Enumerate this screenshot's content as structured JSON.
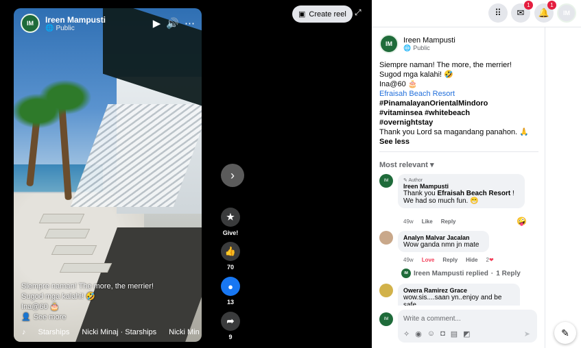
{
  "reel": {
    "author": "Ireen Mampusti",
    "audience": "Public",
    "caption_lines": [
      "Siempre naman! The more, the merrier!",
      "Sugod mga kalahi! 🤣",
      "Ina@60 🎂"
    ],
    "see_more": "See more",
    "music": [
      "Starships",
      "Nicki Minaj · Starships",
      "Nicki Min"
    ],
    "controls": {
      "play_icon": "▶",
      "volume_icon": "🔊",
      "more_icon": "⋯"
    }
  },
  "actions": {
    "give_label": "Give!",
    "like_count": "70",
    "comment_count": "13",
    "share_count": "9"
  },
  "create_reel": {
    "label": "Create reel"
  },
  "topbar": {
    "messenger_badge": "1",
    "notifications_badge": "1"
  },
  "post": {
    "author": "Ireen Mampusti",
    "audience": "Public",
    "line1": "Siempre naman! The more, the merrier!",
    "line2": "Sugod mga kalahi! 🤣",
    "line3": "Ina@60 🎂",
    "location_link": "Efraisah Beach Resort",
    "hashtags1": "#PinamalayanOrientalMindoro",
    "hashtags2": "#vitaminsea #whitebeach",
    "hashtags3": "#overnightstay",
    "line_last": "Thank you Lord sa magandang panahon. 🙏",
    "see_less": "See less"
  },
  "sort": {
    "label": "Most relevant"
  },
  "comments": [
    {
      "author_badge": "Author",
      "name": "Ireen Mampusti",
      "text_prefix": "Thank you ",
      "text_bold": "Efraisah Beach Resort",
      "text_suffix": " !",
      "text_line2": "We had so much fun. 😁",
      "time": "49w",
      "like": "Like",
      "reply": "Reply",
      "reaction": "🤪"
    },
    {
      "name": "Analyn Malvar Jacalan",
      "text": "Wow ganda nmn jn mate",
      "time": "49w",
      "like": "Love",
      "reply": "Reply",
      "hide": "Hide",
      "reaction_count": "2",
      "reaction": "❤"
    },
    {
      "name": "Owera Ramirez Grace",
      "text": "wow.sis....saan yn..enjoy and be safe"
    }
  ],
  "replied": {
    "text": "Ireen Mampusti replied",
    "separator": "·",
    "count": "1 Reply"
  },
  "composer": {
    "placeholder": "Write a comment..."
  },
  "colors": {
    "accent": "#1877f2",
    "badge": "#e41e3f",
    "love": "#f33e58"
  }
}
